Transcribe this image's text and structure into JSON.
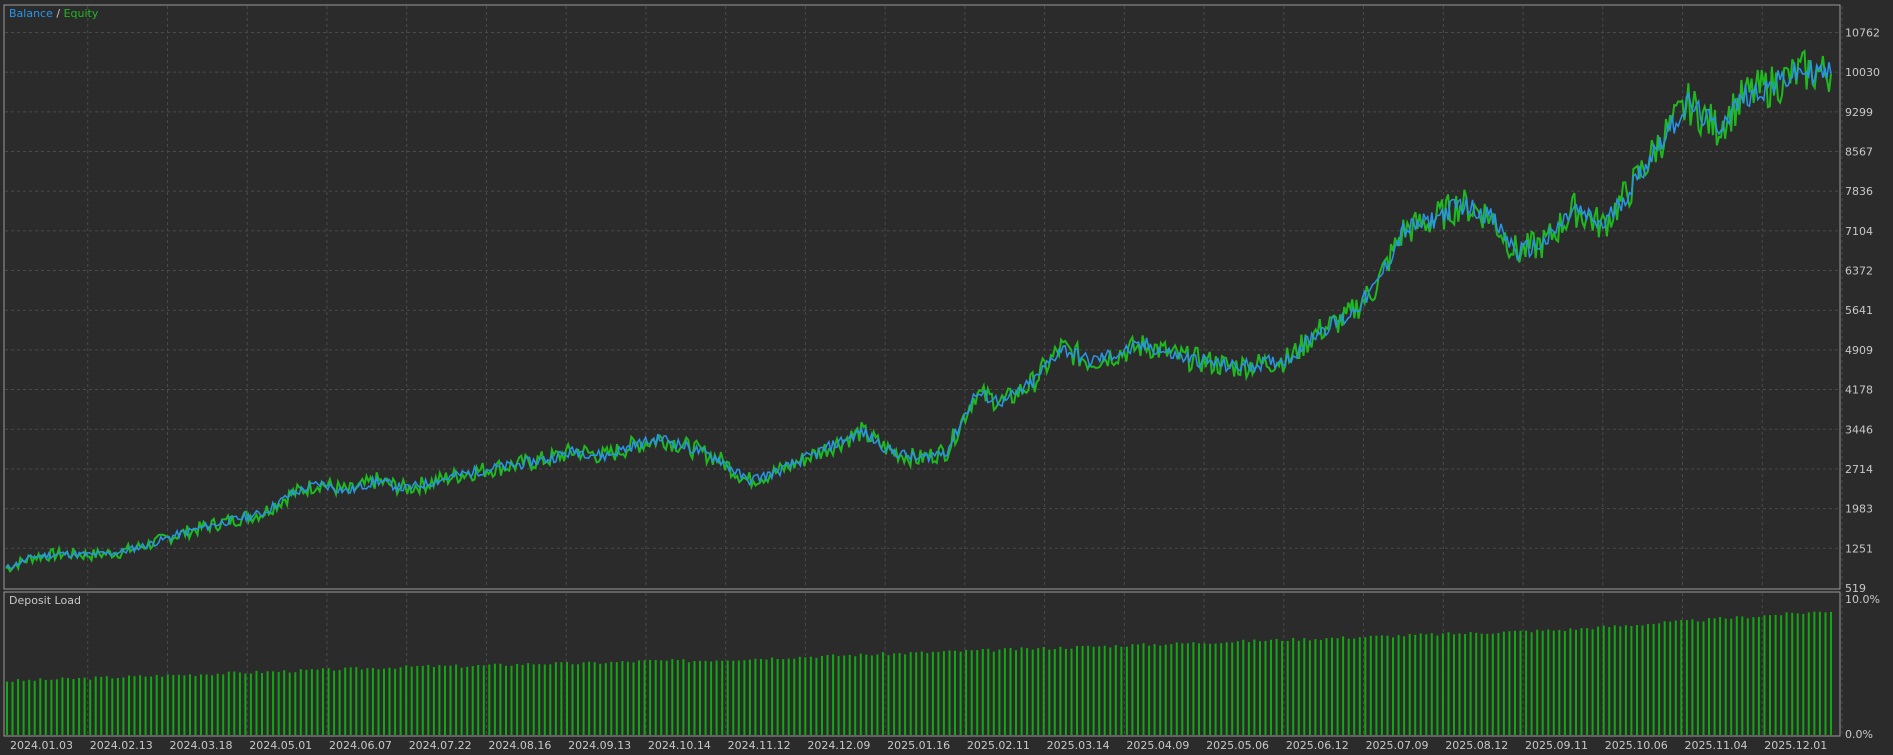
{
  "colors": {
    "background": "#2b2b2b",
    "panel_border": "#9a9a9a",
    "grid": "#4a4a4a",
    "text": "#c8c8c8",
    "balance": "#2a95e8",
    "equity": "#1fb81f",
    "deposit_load": "#12a812"
  },
  "legend": {
    "balance": "Balance",
    "separator": " / ",
    "equity": "Equity"
  },
  "chart_data": [
    {
      "type": "line",
      "grid": true,
      "series": [
        {
          "name": "Balance",
          "values": [
            880,
            1100,
            1150,
            1130,
            1180,
            1320,
            1500,
            1650,
            1780,
            1900,
            2250,
            2450,
            2300,
            2500,
            2350,
            2480,
            2620,
            2720,
            2800,
            2900,
            3050,
            2950,
            3150,
            3280,
            3100,
            2900,
            2500,
            2650,
            2900,
            3150,
            3400,
            3050,
            2900,
            3050,
            4100,
            3950,
            4300,
            4950,
            4700,
            4850,
            5000,
            4800,
            4700,
            4600,
            4650,
            4750,
            5250,
            5500,
            6050,
            7100,
            7300,
            7600,
            7400,
            6700,
            6900,
            7500,
            7200,
            7900,
            8750,
            9450,
            9000,
            9600,
            9800,
            10050,
            10000
          ]
        },
        {
          "name": "Equity",
          "values": [
            880,
            1100,
            1150,
            1130,
            1180,
            1320,
            1500,
            1650,
            1780,
            1900,
            2250,
            2450,
            2300,
            2500,
            2350,
            2480,
            2620,
            2720,
            2800,
            2900,
            3050,
            2950,
            3150,
            3280,
            3100,
            2900,
            2500,
            2650,
            2900,
            3150,
            3400,
            3050,
            2900,
            3050,
            4100,
            3950,
            4300,
            4950,
            4700,
            4850,
            5000,
            4800,
            4700,
            4600,
            4650,
            4750,
            5250,
            5500,
            6050,
            7100,
            7300,
            7600,
            7400,
            6700,
            6900,
            7500,
            7200,
            7900,
            8750,
            9450,
            9000,
            9600,
            9800,
            10050,
            10000
          ]
        }
      ],
      "ylim": [
        519,
        11250
      ],
      "yticks": [
        "10762",
        "10030",
        "9299",
        "8567",
        "7836",
        "7104",
        "6372",
        "5641",
        "4909",
        "4178",
        "3446",
        "2714",
        "1983",
        "1251",
        "519"
      ]
    },
    {
      "type": "bar",
      "title": "Deposit Load",
      "grid": true,
      "series": [
        {
          "name": "Deposit Load",
          "values": [
            4.0,
            4.1,
            4.2,
            4.3,
            4.4,
            4.5,
            4.6,
            4.7,
            4.8,
            4.9,
            5.0,
            5.1,
            5.1,
            5.2,
            5.3,
            5.3,
            5.4,
            5.5,
            5.5,
            5.6,
            5.7,
            5.8,
            5.9,
            6.0,
            6.1,
            6.2,
            6.3,
            6.4,
            6.5,
            6.6,
            6.7,
            6.8,
            6.9,
            7.0,
            7.1,
            7.2,
            7.3,
            7.4,
            7.5,
            7.6,
            7.7,
            7.8,
            8.0,
            8.2,
            8.4,
            8.6,
            8.8,
            9.0,
            9.2
          ]
        }
      ],
      "ylim": [
        0,
        10
      ],
      "yticks": [
        "10.0%",
        "0.0%"
      ]
    }
  ],
  "xticks": [
    "2024.01.03",
    "2024.02.13",
    "2024.03.18",
    "2024.05.01",
    "2024.06.07",
    "2024.07.22",
    "2024.08.16",
    "2024.09.13",
    "2024.10.14",
    "2024.11.12",
    "2024.12.09",
    "2025.01.16",
    "2025.02.11",
    "2025.03.14",
    "2025.04.09",
    "2025.05.06",
    "2025.06.12",
    "2025.07.09",
    "2025.08.12",
    "2025.09.11",
    "2025.10.06",
    "2025.11.04",
    "2025.12.01"
  ]
}
